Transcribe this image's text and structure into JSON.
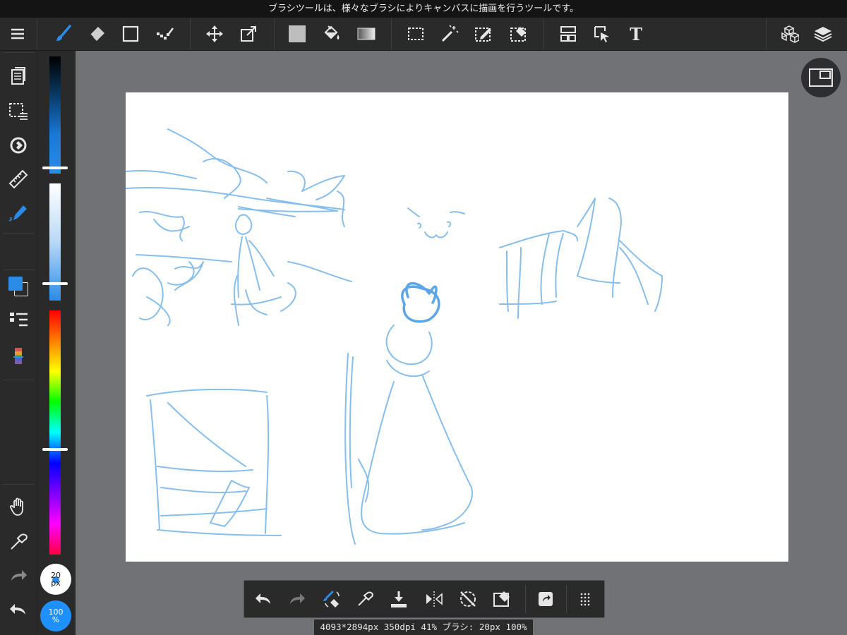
{
  "tip_text": "ブラシツールは、様々なブラシによりキャンバスに描画を行うツールです。",
  "toolbar": {
    "icons": [
      "menu-icon",
      "brush-icon",
      "eraser-icon",
      "rectangle-icon",
      "dot-icon",
      "move-icon",
      "transform-icon",
      "fill-color-icon",
      "bucket-icon",
      "gradient-icon",
      "select-rect-icon",
      "magic-wand-icon",
      "select-pen-icon",
      "select-eraser-icon",
      "frame-divider-icon",
      "operation-icon",
      "text-icon",
      "3d-icon",
      "layers-icon"
    ],
    "text_tool_label": "T"
  },
  "left_panel": {
    "brush_size_label": "20\npx",
    "opacity_label": "100\n%",
    "foreground_color": "#2a8ce6",
    "background_color": "#ffffff"
  },
  "colors": {
    "accent": "#1e90ff",
    "sketch": "#7bb7ea",
    "toolbar_bg": "#2a2a2b",
    "canvas_bg": "#707276"
  },
  "status_bar": "4093*2894px 350dpi 41% ブラシ: 20px 100%"
}
